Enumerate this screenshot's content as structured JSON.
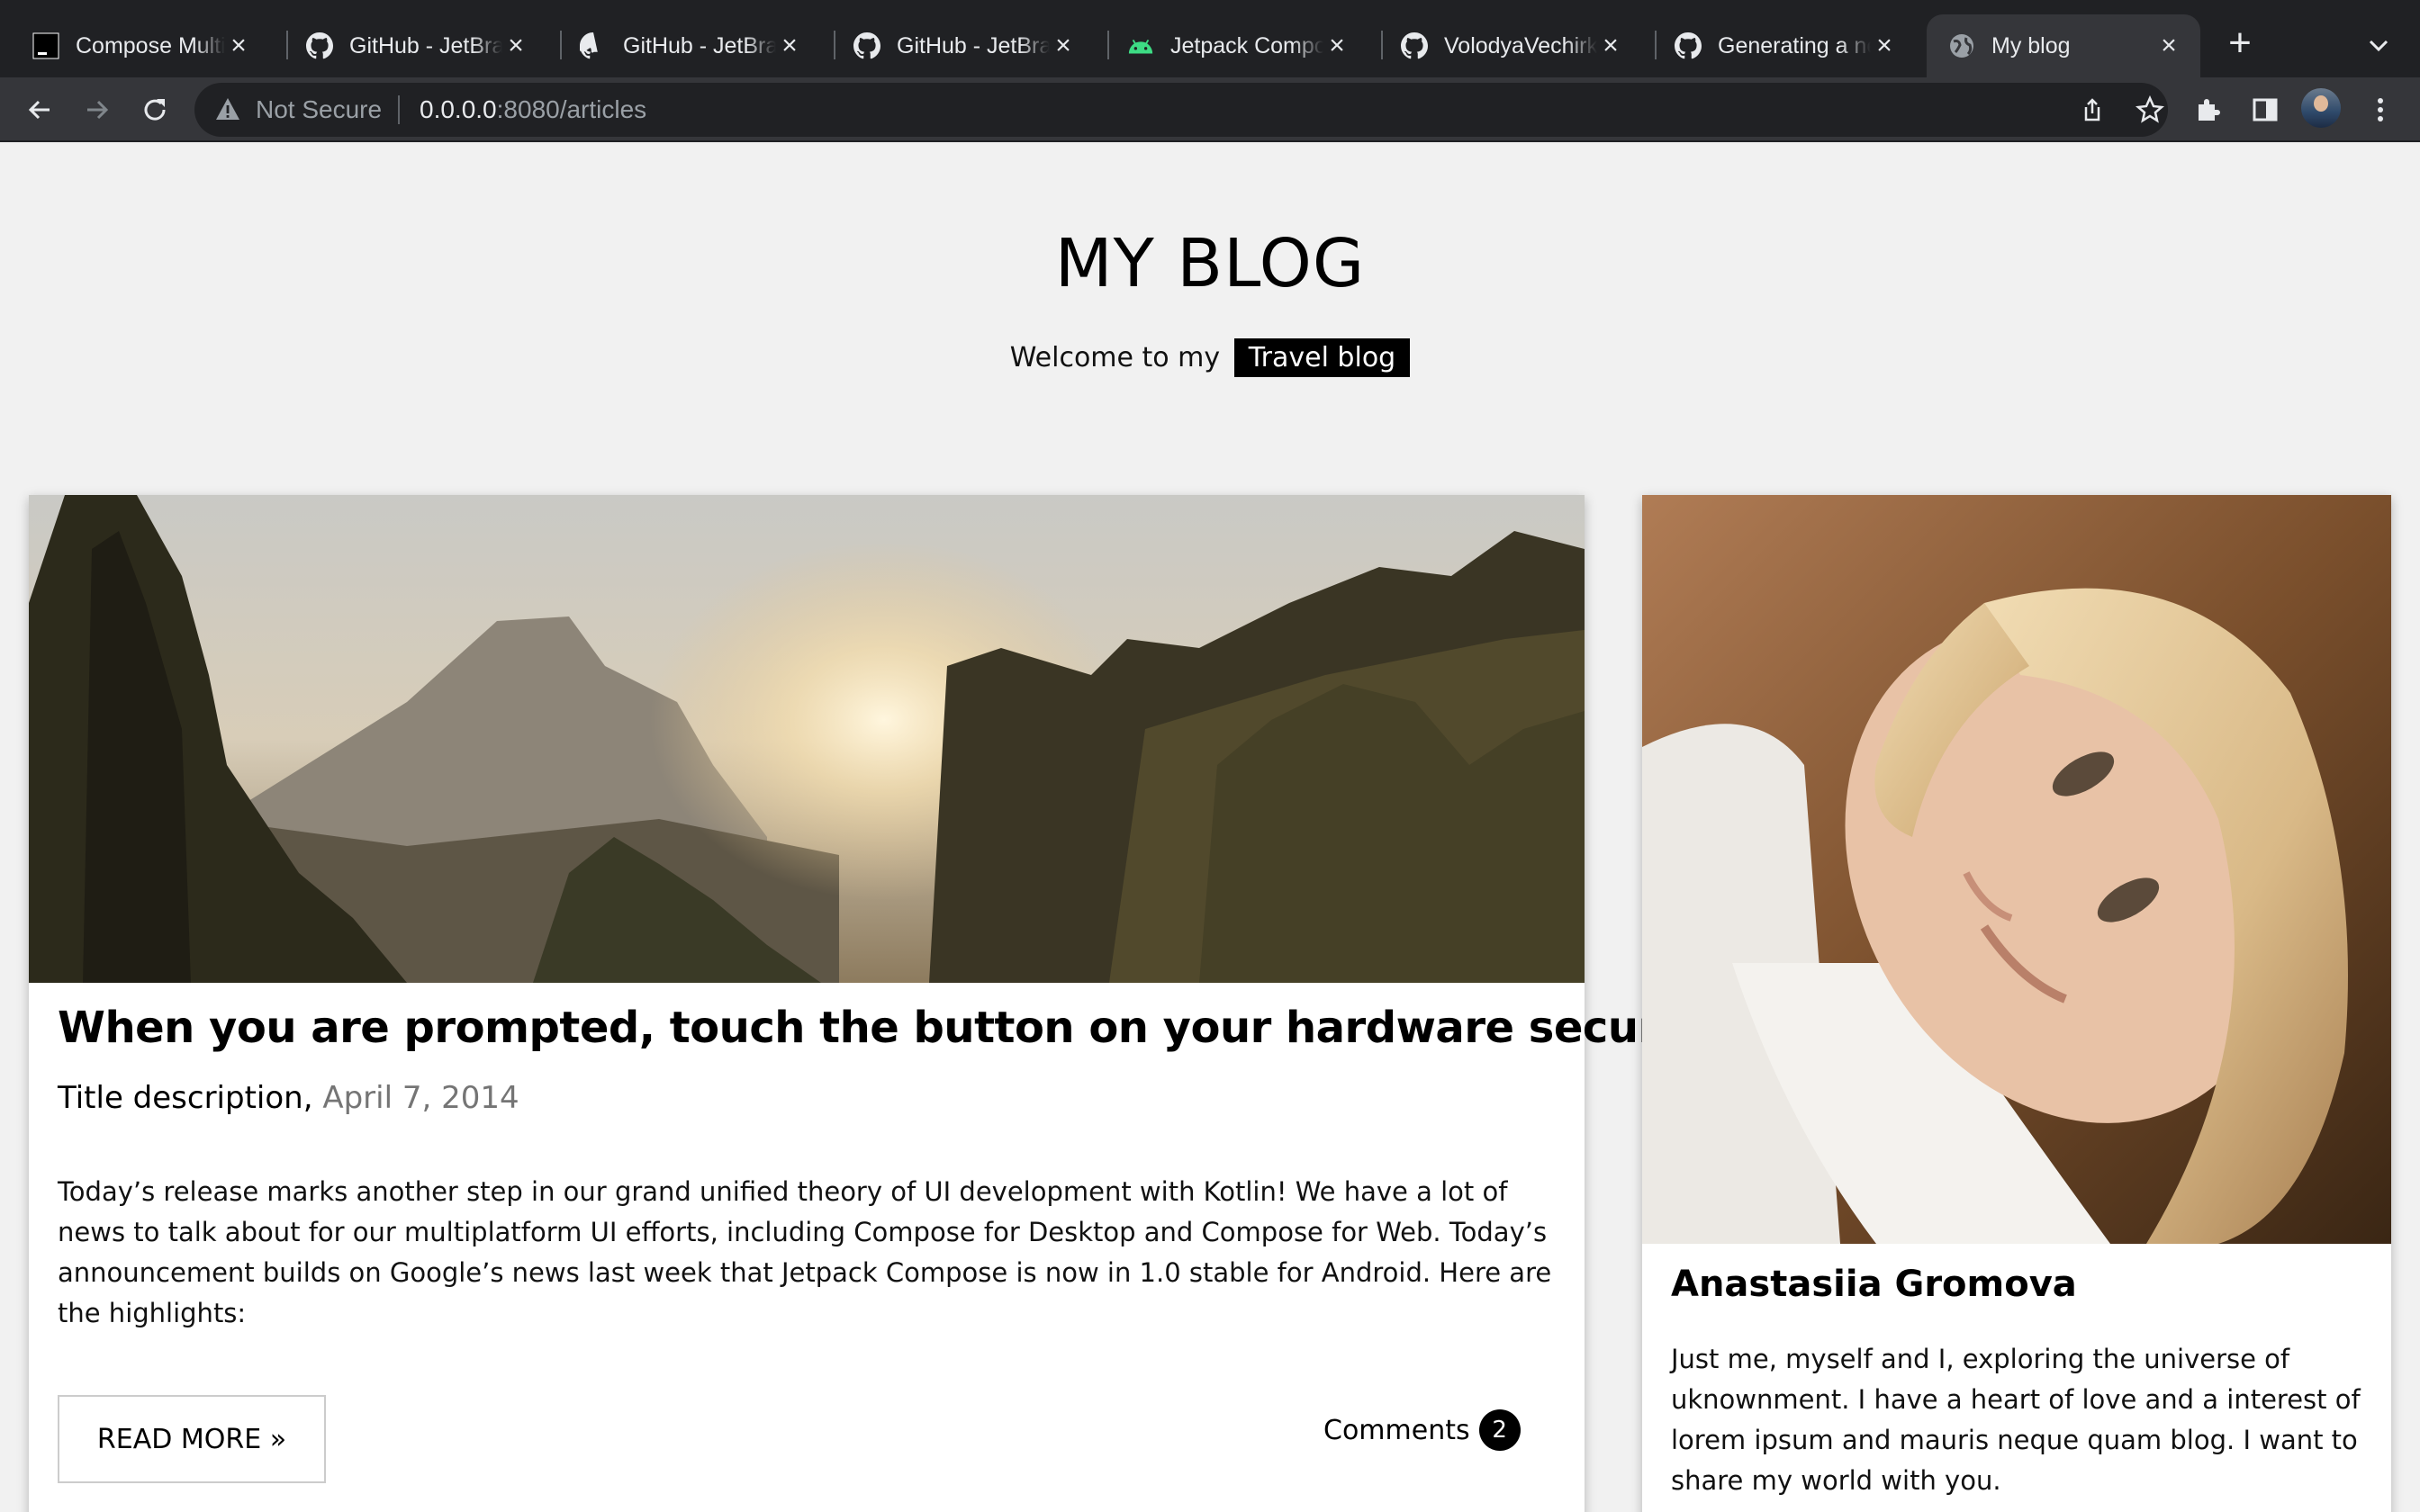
{
  "browser": {
    "tabs": [
      {
        "title": "Compose Multiplatform",
        "icon": "terminal-icon",
        "active": false
      },
      {
        "title": "GitHub - JetBrains",
        "icon": "github-icon",
        "active": false
      },
      {
        "title": "GitHub - JetBrains",
        "icon": "github-icon",
        "active": false
      },
      {
        "title": "GitHub - JetBrains",
        "icon": "github-icon",
        "active": false
      },
      {
        "title": "Jetpack Compose",
        "icon": "android-icon",
        "active": false
      },
      {
        "title": "VolodyaVechirko",
        "icon": "github-icon",
        "active": false
      },
      {
        "title": "Generating a new",
        "icon": "github-icon",
        "active": false
      },
      {
        "title": "My blog",
        "icon": "globe-icon",
        "active": true
      }
    ],
    "security_label": "Not Secure",
    "url_host": "0.0.0.0",
    "url_rest": ":8080/articles"
  },
  "blog": {
    "title": "MY BLOG",
    "welcome_prefix": "Welcome to my",
    "welcome_tag": "Travel blog"
  },
  "article": {
    "title": "When you are prompted, touch the button on your hardware security key.",
    "subtitle": "Title description,",
    "date": "April 7, 2014",
    "body": "Today’s release marks another step in our grand unified theory of UI development with Kotlin! We have a lot of news to talk about for our multiplatform UI efforts, including Compose for Desktop and Compose for Web. Today’s announcement builds on Google’s news last week that Jetpack Compose is now in 1.0 stable for Android. Here are the highlights:",
    "read_more_label": "READ MORE »",
    "comments_label": "Comments",
    "comments_count": "2"
  },
  "author": {
    "name": "Anastasiia Gromova",
    "bio": "Just me, myself and I, exploring the universe of uknownment. I have a heart of love and a interest of lorem ipsum and mauris neque quam blog. I want to share my world with you."
  }
}
